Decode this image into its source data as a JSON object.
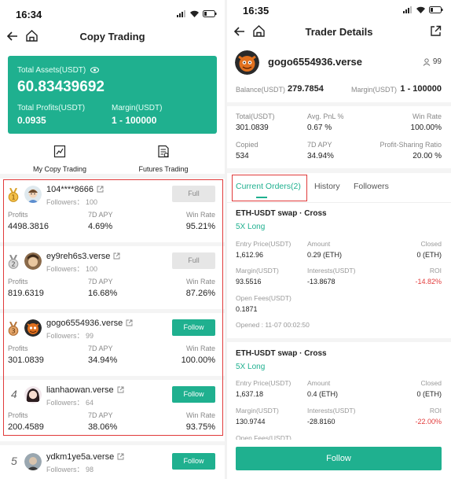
{
  "left": {
    "status_time": "16:34",
    "title": "Copy Trading",
    "assets_card": {
      "total_assets_label": "Total Assets(USDT)",
      "total_assets_value": "60.83439692",
      "total_profits_label": "Total Profits(USDT)",
      "total_profits_value": "0.0935",
      "margin_label": "Margin(USDT)",
      "margin_value": "1 - 100000"
    },
    "quick_links": [
      {
        "label": "My Copy Trading",
        "icon": "chart-icon"
      },
      {
        "label": "Futures Trading",
        "icon": "document-icon"
      }
    ],
    "stat_labels": {
      "profits": "Profits",
      "apy": "7D APY",
      "winrate": "Win Rate"
    },
    "traders": [
      {
        "rank": "1",
        "name": "104****8666",
        "followers": "Followers： 100",
        "button": "Full",
        "profits": "4498.3816",
        "apy": "4.69%",
        "winrate": "95.21%"
      },
      {
        "rank": "2",
        "name": "ey9reh6s3.verse",
        "followers": "Followers： 100",
        "button": "Full",
        "profits": "819.6319",
        "apy": "16.68%",
        "winrate": "87.26%"
      },
      {
        "rank": "3",
        "name": "gogo6554936.verse",
        "followers": "Followers： 99",
        "button": "Follow",
        "profits": "301.0839",
        "apy": "34.94%",
        "winrate": "100.00%"
      },
      {
        "rank": "4",
        "name": "lianhaowan.verse",
        "followers": "Followers： 64",
        "button": "Follow",
        "profits": "200.4589",
        "apy": "38.06%",
        "winrate": "93.75%"
      },
      {
        "rank": "5",
        "name": "ydkm1ye5a.verse",
        "followers": "Followers： 98",
        "button": "Follow"
      }
    ]
  },
  "right": {
    "status_time": "16:35",
    "title": "Trader Details",
    "trader_name": "gogo6554936.verse",
    "follower_count": "99",
    "balance_label": "Balance(USDT)",
    "balance_value": "279.7854",
    "margin_label": "Margin(USDT)",
    "margin_value": "1 - 100000",
    "stats": {
      "total_label": "Total(USDT)",
      "total_value": "301.0839",
      "avg_pnl_label": "Avg. PnL %",
      "avg_pnl_value": "0.67 %",
      "winrate_label": "Win Rate",
      "winrate_value": "100.00%",
      "copied_label": "Copied",
      "copied_value": "534",
      "apy_label": "7D APY",
      "apy_value": "34.94%",
      "profit_sharing_label": "Profit-Sharing Ratio",
      "profit_sharing_value": "20.00 %"
    },
    "tabs": [
      "Current Orders(2)",
      "History",
      "Followers"
    ],
    "order_labels": {
      "entry_price": "Entry Price(USDT)",
      "amount": "Amount",
      "closed": "Closed",
      "margin": "Margin(USDT)",
      "interests": "Interests(USDT)",
      "roi": "ROI",
      "open_fees": "Open Fees(USDT)"
    },
    "orders": [
      {
        "title": "ETH-USDT swap · Cross",
        "leverage": "5X Long",
        "entry_price": "1,612.96",
        "amount": "0.29 (ETH)",
        "closed": "0 (ETH)",
        "margin": "93.5516",
        "interests": "-13.8678",
        "roi": "-14.82%",
        "open_fees": "0.1871",
        "opened": "Opened : 11-07 00:02:50"
      },
      {
        "title": "ETH-USDT swap · Cross",
        "leverage": "5X Long",
        "entry_price": "1,637.18",
        "amount": "0.4 (ETH)",
        "closed": "0 (ETH)",
        "margin": "130.9744",
        "interests": "-28.8160",
        "roi": "-22.00%",
        "open_fees": "Open Fees(USDT)"
      }
    ],
    "follow_button": "Follow"
  },
  "colors": {
    "accent": "#1fb08f",
    "negative": "#e23b3b",
    "highlight_box": "#e03a3a"
  }
}
